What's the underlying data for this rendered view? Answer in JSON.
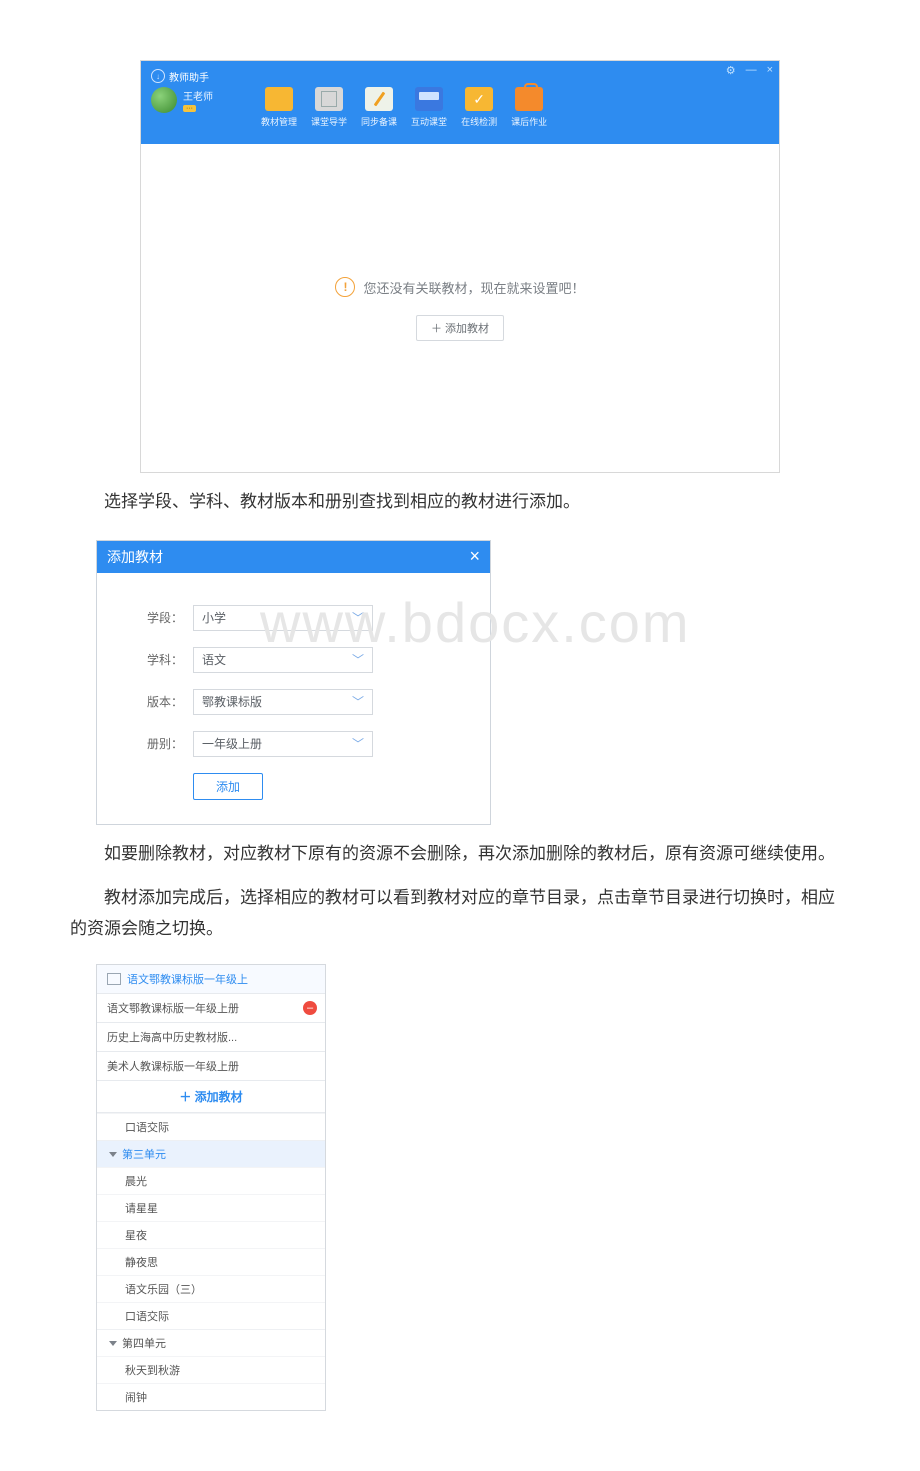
{
  "app": {
    "title": "教师助手",
    "user_name": "王老师",
    "user_badge": "···",
    "win_controls": {
      "settings": "⚙",
      "min": "—",
      "close": "×"
    },
    "nav": [
      {
        "label": "教材管理",
        "icon": "folder-icon"
      },
      {
        "label": "课堂导学",
        "icon": "doc-icon"
      },
      {
        "label": "同步备课",
        "icon": "pencil-icon"
      },
      {
        "label": "互动课堂",
        "icon": "board-icon"
      },
      {
        "label": "在线检测",
        "icon": "check-icon"
      },
      {
        "label": "课后作业",
        "icon": "bag-icon"
      }
    ],
    "empty_hint": "您还没有关联教材，现在就来设置吧！",
    "add_button": "＋ 添加教材"
  },
  "doc": {
    "line1": "选择学段、学科、教材版本和册别查找到相应的教材进行添加。",
    "line2": "如要删除教材，对应教材下原有的资源不会删除，再次添加删除的教材后，原有资源可继续使用。",
    "line3": "教材添加完成后，选择相应的教材可以看到教材对应的章节目录，点击章节目录进行切换时，相应的资源会随之切换。"
  },
  "watermark": "www.bdocx.com",
  "dialog": {
    "title": "添加教材",
    "close": "×",
    "fields": {
      "stage_label": "学段：",
      "stage_value": "小学",
      "subject_label": "学科：",
      "subject_value": "语文",
      "version_label": "版本：",
      "version_value": "鄂教课标版",
      "volume_label": "册别：",
      "volume_value": "一年级上册"
    },
    "submit": "添加"
  },
  "chapters": {
    "books": [
      {
        "label": "语文鄂教课标版一年级上",
        "selected": true,
        "icon": true
      },
      {
        "label": "语文鄂教课标版一年级上册",
        "selected": false,
        "removable": true
      },
      {
        "label": "历史上海高中历史教材版...",
        "selected": false
      },
      {
        "label": "美术人教课标版一年级上册",
        "selected": false
      }
    ],
    "add_label": "＋ 添加教材",
    "leading_leaf": "口语交际",
    "units": [
      {
        "title": "第三单元",
        "selected": true,
        "items": [
          "晨光",
          "请星星",
          "星夜",
          "静夜思",
          "语文乐园（三）",
          "口语交际"
        ]
      },
      {
        "title": "第四单元",
        "selected": false,
        "items": [
          "秋天到秋游",
          "闹钟"
        ]
      }
    ]
  }
}
